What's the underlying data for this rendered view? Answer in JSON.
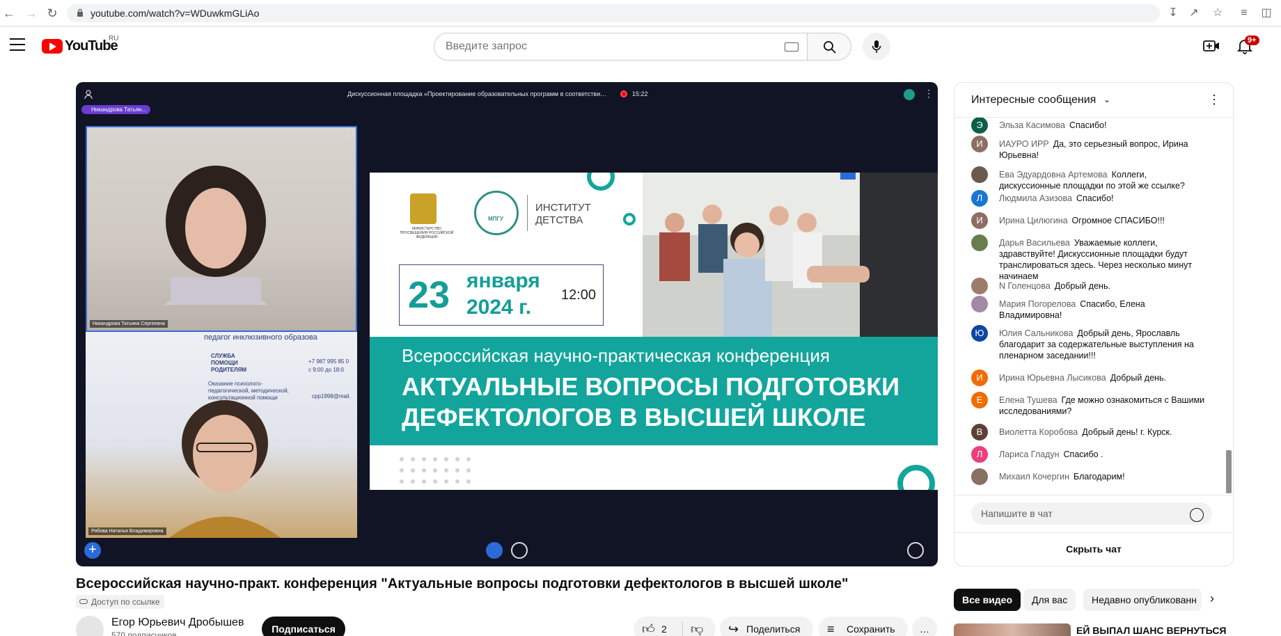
{
  "browser": {
    "url": "youtube.com/watch?v=WDuwkmGLiAo"
  },
  "header": {
    "logo_text": "YouTube",
    "country": "RU",
    "search_placeholder": "Введите запрос",
    "notifications_badge": "9+"
  },
  "player": {
    "meeting_title": "Дискуссионная площадка «Проектирование образовательных программ в соответстви…",
    "rec_time": "15:22",
    "active_speaker_badge": "Никандрова Татьян...",
    "cam1_label": "Никандрова Татьяна Сергеевна",
    "cam2_label": "Рябова Наталья Владимировна",
    "slide": {
      "ministry": "МИНИСТЕРСТВО ПРОСВЕЩЕНИЯ РОССИЙСКОЙ ФЕДЕРАЦИИ",
      "university": "МПГУ",
      "institute": "ИНСТИТУТ ДЕТСТВА",
      "day": "23",
      "month_year": "января 2024 г.",
      "time": "12:00",
      "subtitle": "Всероссийская научно-практическая конференция",
      "headline_1": "АКТУАЛЬНЫЕ ВОПРОСЫ  ПОДГОТОВКИ",
      "headline_2": "ДЕФЕКТОЛОГОВ В ВЫСШЕЙ ШКОЛЕ"
    },
    "cam2_poster": {
      "line1": "педагог инклюзивного образова",
      "service": "СЛУЖБА ПОМОЩИ РОДИТЕЛЯМ",
      "phone": "+7 987 995 85 0",
      "hours": "с 9:00 до 18:0",
      "desc": "Оказание психолого-педагогической, методической, консультационной помощи",
      "email": "cpp1998@mail."
    },
    "colors": {
      "accent": "#13a59c",
      "background": "#101425"
    }
  },
  "chat": {
    "title": "Интересные сообщения",
    "input_placeholder": "Напишите в чат",
    "hide_label": "Скрыть чат",
    "messages": [
      {
        "initial": "Э",
        "color": "#0b5e4a",
        "author": "Эльза Касимова",
        "text": "Спасибо!"
      },
      {
        "initial": "И",
        "color": "#8d6e63",
        "author": "ИАУРО ИРР",
        "text": "Да, это серьезный вопрос, Ирина Юрьевна!"
      },
      {
        "initial": "",
        "color": "#6d5a4e",
        "author": "Ева Эдуардовна Артемова",
        "text": "Коллеги, дискуссионные площадки по этой же ссылке?"
      },
      {
        "initial": "Л",
        "color": "#1976d2",
        "author": "Людмила Азизова",
        "text": "Спасибо!"
      },
      {
        "initial": "И",
        "color": "#8d6e63",
        "author": "Ирина Цилюгина",
        "text": "Огромное СПАСИБО!!!"
      },
      {
        "initial": "",
        "color": "#6b7d4e",
        "author": "Дарья Васильева",
        "text": "Уважаемые коллеги, здравствуйте! Дискуссионные площадки будут транслироваться здесь. Через несколько минут начинаем"
      },
      {
        "initial": "",
        "color": "#9c7b6a",
        "author": "N Голенцова",
        "text": "Добрый день."
      },
      {
        "initial": "",
        "color": "#a08aa8",
        "author": "Мария Погорелова",
        "text": "Спасибо, Елена Владимировна!"
      },
      {
        "initial": "Ю",
        "color": "#0d47a1",
        "author": "Юлия Сальникова",
        "text": "Добрый день, Ярославль благодарит за содержательные выступления на пленарном заседании!!!"
      },
      {
        "initial": "И",
        "color": "#ef6c00",
        "author": "Ирина Юрьевна Лысикова",
        "text": "Добрый день."
      },
      {
        "initial": "Е",
        "color": "#ef6c00",
        "author": "Елена Тушева",
        "text": "Где можно ознакомиться с Вашими исследованиями?"
      },
      {
        "initial": "В",
        "color": "#5d4037",
        "author": "Виолетта Коробова",
        "text": "Добрый день! г. Курск."
      },
      {
        "initial": "Л",
        "color": "#ec407a",
        "author": "Лариса Гладун",
        "text": "Спасибо ."
      },
      {
        "initial": "",
        "color": "#8a6f63",
        "author": "Михаил Кочергин",
        "text": "Благодарим!"
      }
    ]
  },
  "video": {
    "title": "Всероссийская научно-практ. конференция \"Актуальные вопросы подготовки дефектологов в высшей школе\"",
    "access": "Доступ по ссылке",
    "channel": "Егор Юрьевич Дробышев",
    "subscribers": "570 подписчиков",
    "subscribe_label": "Подписаться",
    "likes": "2",
    "share_label": "Поделиться",
    "save_label": "Сохранить",
    "more_label": "…"
  },
  "recommendations": {
    "chips": [
      "Все видео",
      "Для вас",
      "Недавно опубликованн"
    ],
    "next_title": "ЕЙ ВЫПАЛ ШАНС ВЕРНУТЬСЯ"
  }
}
